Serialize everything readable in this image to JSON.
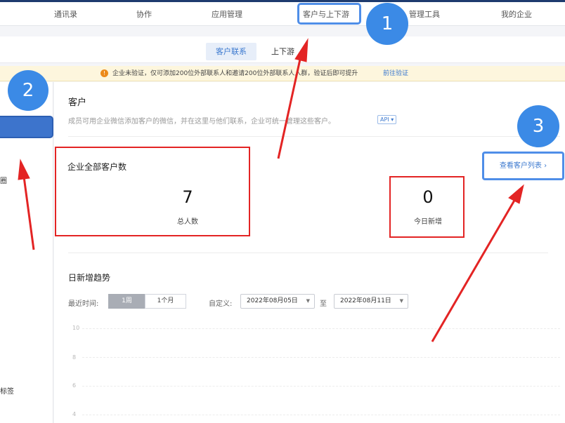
{
  "nav": {
    "items": [
      {
        "label": "通讯录"
      },
      {
        "label": "协作"
      },
      {
        "label": "应用管理"
      },
      {
        "label": "客户与上下游"
      },
      {
        "label": "管理工具"
      },
      {
        "label": "我的企业"
      }
    ]
  },
  "subtabs": [
    {
      "label": "客户联系",
      "active": true
    },
    {
      "label": "上下游",
      "active": false
    }
  ],
  "notice": {
    "icon": "warning-icon",
    "text": "企业未验证，仅可添加200位外部联系人和邀请200位外部联系人入群，验证后即可提升",
    "link": "前往验证"
  },
  "sidebar": {
    "fragments": [
      "圈",
      "标签"
    ]
  },
  "main": {
    "title": "客户",
    "description": "成员可用企业微信添加客户的微信，并在这里与他们联系，企业可统一管理这些客户。",
    "api_badge": "API ▾",
    "stats_title": "企业全部客户数",
    "total_value": "7",
    "total_label": "总人数",
    "today_value": "0",
    "today_label": "今日新增",
    "view_list": "查看客户列表 ›"
  },
  "trend": {
    "title": "日新增趋势",
    "recent_label": "最近时间:",
    "seg_week": "1周",
    "seg_month": "1个月",
    "custom_label": "自定义:",
    "start_date": "2022年08月05日",
    "to_label": "至",
    "end_date": "2022年08月11日",
    "y_ticks": [
      "10",
      "8",
      "6",
      "4"
    ]
  },
  "annotations": {
    "circle1": "1",
    "circle2": "2",
    "circle3": "3",
    "accent": "#3b8ae6",
    "arrow_color": "#e32424"
  }
}
